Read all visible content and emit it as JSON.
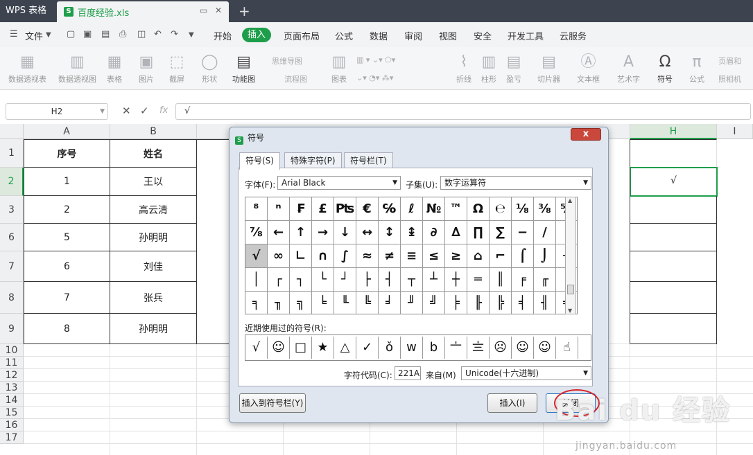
{
  "titlebar": {
    "app": "WPS 表格",
    "file": "百度经验.xls",
    "file_icon": "S"
  },
  "menubar": {
    "file_label": "文件",
    "tabs": [
      "开始",
      "插入",
      "页面布局",
      "公式",
      "数据",
      "审阅",
      "视图",
      "安全",
      "开发工具",
      "云服务"
    ],
    "active_tab": "插入"
  },
  "ribbon": {
    "buttons": [
      "数据透视表",
      "数据透视图",
      "表格",
      "图片",
      "截屏",
      "形状",
      "功能图",
      "图表",
      "折线",
      "柱形",
      "盈亏",
      "切片器",
      "文本框",
      "艺术字",
      "符号",
      "公式"
    ],
    "small": [
      "思维导图",
      "流程图",
      "页眉和",
      "照相机"
    ]
  },
  "formula_bar": {
    "cell_ref": "H2",
    "value": "√",
    "fx": "fx"
  },
  "sheet": {
    "columns": [
      "A",
      "B",
      "H",
      "I"
    ],
    "rows": [
      "1",
      "2",
      "3",
      "6",
      "7",
      "8",
      "9",
      "10",
      "11",
      "12",
      "13",
      "14",
      "15",
      "16",
      "17"
    ],
    "header": [
      "序号",
      "姓名"
    ],
    "data": [
      [
        "1",
        "王以"
      ],
      [
        "2",
        "高云清"
      ],
      [
        "5",
        "孙明明"
      ],
      [
        "6",
        "刘佳"
      ],
      [
        "7",
        "张兵"
      ],
      [
        "8",
        "孙明明"
      ]
    ],
    "h2": "√"
  },
  "dialog": {
    "title": "符号",
    "close": "x",
    "tabs": [
      "符号(S)",
      "特殊字符(P)",
      "符号栏(T)"
    ],
    "font_label": "字体(F):",
    "font_value": "Arial Black",
    "subset_label": "子集(U):",
    "subset_value": "数字运算符",
    "symbols": [
      [
        "⁸",
        "ⁿ",
        "₣",
        "£",
        "₧",
        "€",
        "℅",
        "ℓ",
        "№",
        "™",
        "Ω",
        "℮",
        "⅛",
        "⅜",
        "⅝"
      ],
      [
        "⅞",
        "←",
        "↑",
        "→",
        "↓",
        "↔",
        "↕",
        "↨",
        "∂",
        "∆",
        "∏",
        "∑",
        "−",
        "∕",
        "∙"
      ],
      [
        "√",
        "∞",
        "∟",
        "∩",
        "∫",
        "≈",
        "≠",
        "≡",
        "≤",
        "≥",
        "⌂",
        "⌐",
        "⌠",
        "⌡",
        "─"
      ],
      [
        "│",
        "┌",
        "┐",
        "└",
        "┘",
        "├",
        "┤",
        "┬",
        "┴",
        "┼",
        "═",
        "║",
        "╒",
        "╓",
        "╔"
      ],
      [
        "╕",
        "╖",
        "╗",
        "╘",
        "╙",
        "╚",
        "╛",
        "╜",
        "╝",
        "╞",
        "╟",
        "╠",
        "╡",
        "╢",
        "╣"
      ]
    ],
    "selected_symbol": "√",
    "recent_label": "近期使用过的符号(R):",
    "recent": [
      "√",
      "☺",
      "□",
      "★",
      "△",
      "✓",
      "ǒ",
      "w",
      "b",
      "〦",
      "〨",
      "☹",
      "☺",
      "☺",
      "☝"
    ],
    "code_label": "字符代码(C):",
    "code_value": "221A",
    "from_label": "来自(M)",
    "from_value": "Unicode(十六进制)",
    "btn_add_bar": "插入到符号栏(Y)",
    "btn_insert": "插入(I)",
    "btn_close": "关闭"
  },
  "watermark": {
    "text": "Bai du 经验",
    "url": "jingyan.baidu.com"
  }
}
